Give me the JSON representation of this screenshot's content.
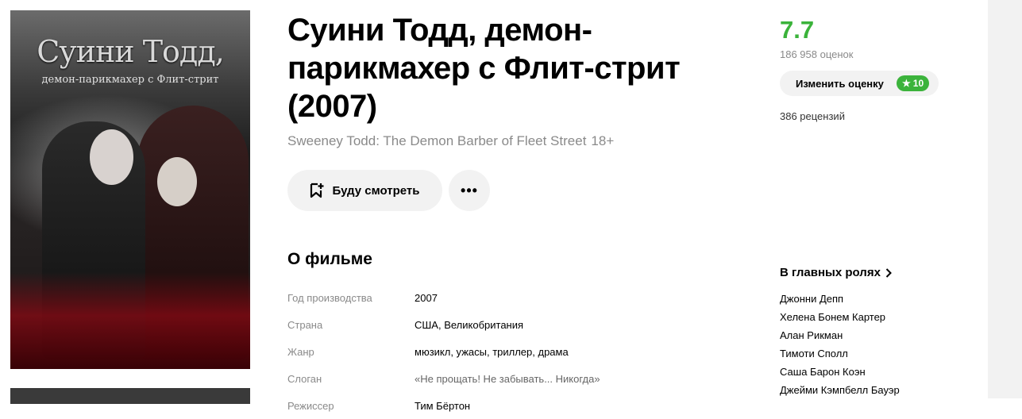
{
  "poster": {
    "title_line1": "Суини Тодд,",
    "title_line2": "демон-парикмахер с Флит-стрит"
  },
  "movie": {
    "title": "Суини Тодд, демон-парикмахер с Флит-стрит (2007)",
    "original_title": "Sweeney Todd: The Demon Barber of Fleet Street",
    "age_rating": "18+"
  },
  "actions": {
    "watchlist_label": "Буду смотреть",
    "watchlist_icon": "bookmark-plus-icon",
    "more_label": "•••"
  },
  "rating": {
    "value": "7.7",
    "color": "#3bb33b",
    "votes": "186 958 оценок",
    "change_label": "Изменить оценку",
    "user_score": "10",
    "user_score_icon": "★",
    "reviews": "386 рецензий"
  },
  "about": {
    "heading": "О фильме",
    "facts": [
      {
        "label": "Год производства",
        "value": "2007"
      },
      {
        "label": "Страна",
        "value": "США, Великобритания"
      },
      {
        "label": "Жанр",
        "value": "мюзикл, ужасы, триллер, драма"
      },
      {
        "label": "Слоган",
        "value": "«Не прощать! Не забывать... Никогда»"
      },
      {
        "label": "Режиссер",
        "value": "Тим Бёртон"
      }
    ]
  },
  "cast": {
    "heading": "В главных ролях",
    "actors": [
      "Джонни Депп",
      "Хелена Бонем Картер",
      "Алан Рикман",
      "Тимоти Сполл",
      "Саша Барон Коэн",
      "Джейми Кэмпбелл Бауэр"
    ]
  }
}
